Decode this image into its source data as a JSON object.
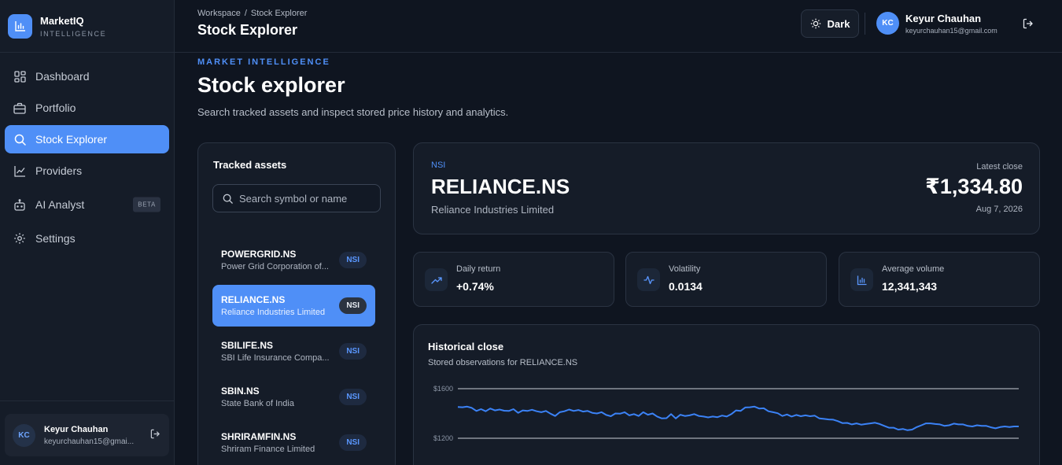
{
  "brand": {
    "name": "MarketIQ",
    "subtitle": "INTELLIGENCE"
  },
  "sidebar": {
    "items": [
      {
        "label": "Dashboard",
        "icon": "grid-icon"
      },
      {
        "label": "Portfolio",
        "icon": "briefcase-icon"
      },
      {
        "label": "Stock Explorer",
        "icon": "search-icon",
        "active": true
      },
      {
        "label": "Providers",
        "icon": "line-chart-icon"
      },
      {
        "label": "AI Analyst",
        "icon": "bot-icon",
        "badge": "BETA"
      },
      {
        "label": "Settings",
        "icon": "gear-icon"
      }
    ],
    "user": {
      "initials": "KC",
      "name": "Keyur Chauhan",
      "email": "keyurchauhan15@gmai..."
    }
  },
  "topbar": {
    "breadcrumb": [
      "Workspace",
      "Stock Explorer"
    ],
    "breadcrumb_sep": "/",
    "title": "Stock Explorer",
    "theme_label": "Dark",
    "user": {
      "initials": "KC",
      "name": "Keyur Chauhan",
      "email": "keyurchauhan15@gmail.com"
    }
  },
  "header": {
    "eyebrow": "MARKET INTELLIGENCE",
    "title": "Stock explorer",
    "description": "Search tracked assets and inspect stored price history and analytics."
  },
  "assets": {
    "title": "Tracked assets",
    "search_placeholder": "Search symbol or name",
    "items": [
      {
        "symbol": "POWERGRID.NS",
        "name": "Power Grid Corporation of...",
        "exchange": "NSI"
      },
      {
        "symbol": "RELIANCE.NS",
        "name": "Reliance Industries Limited",
        "exchange": "NSI",
        "active": true
      },
      {
        "symbol": "SBILIFE.NS",
        "name": "SBI Life Insurance Compa...",
        "exchange": "NSI"
      },
      {
        "symbol": "SBIN.NS",
        "name": "State Bank of India",
        "exchange": "NSI"
      },
      {
        "symbol": "SHRIRAMFIN.NS",
        "name": "Shriram Finance Limited",
        "exchange": "NSI"
      }
    ]
  },
  "detail": {
    "exchange": "NSI",
    "symbol": "RELIANCE.NS",
    "name": "Reliance Industries Limited",
    "latest_label": "Latest close",
    "price": "₹1,334.80",
    "date": "Aug 7, 2026"
  },
  "metrics": [
    {
      "label": "Daily return",
      "value": "+0.74%",
      "icon": "trend-up-icon"
    },
    {
      "label": "Volatility",
      "value": "0.0134",
      "icon": "activity-icon"
    },
    {
      "label": "Average volume",
      "value": "12,341,343",
      "icon": "bar-chart-icon"
    }
  ],
  "chart": {
    "title": "Historical close",
    "subtitle": "Stored observations for RELIANCE.NS",
    "colors": {
      "line": "#3b82f6",
      "grid": "#c9ced6"
    }
  },
  "chart_data": {
    "type": "line",
    "ylim": [
      1200,
      1600
    ],
    "yticks": [
      "$1600",
      "$1200"
    ],
    "ytick_values": [
      1600,
      1200
    ],
    "series": [
      {
        "values": [
          1452,
          1450,
          1455,
          1445,
          1420,
          1435,
          1418,
          1440,
          1425,
          1432,
          1422,
          1420,
          1435,
          1405,
          1425,
          1420,
          1430,
          1418,
          1410,
          1420,
          1398,
          1380,
          1410,
          1418,
          1432,
          1420,
          1428,
          1415,
          1420,
          1405,
          1400,
          1410,
          1388,
          1378,
          1400,
          1398,
          1410,
          1385,
          1395,
          1380,
          1410,
          1390,
          1400,
          1375,
          1360,
          1362,
          1395,
          1360,
          1390,
          1380,
          1385,
          1395,
          1380,
          1375,
          1368,
          1375,
          1370,
          1383,
          1375,
          1395,
          1425,
          1420,
          1448,
          1450,
          1455,
          1440,
          1442,
          1418,
          1410,
          1402,
          1380,
          1392,
          1375,
          1388,
          1378,
          1385,
          1378,
          1382,
          1360,
          1356,
          1352,
          1350,
          1338,
          1322,
          1324,
          1312,
          1320,
          1310,
          1315,
          1320,
          1325,
          1315,
          1300,
          1285,
          1285,
          1270,
          1275,
          1265,
          1270,
          1290,
          1305,
          1320,
          1320,
          1315,
          1312,
          1300,
          1305,
          1318,
          1312,
          1312,
          1300,
          1295,
          1305,
          1300,
          1300,
          1288,
          1280,
          1290,
          1295,
          1290,
          1295,
          1295
        ]
      }
    ]
  }
}
